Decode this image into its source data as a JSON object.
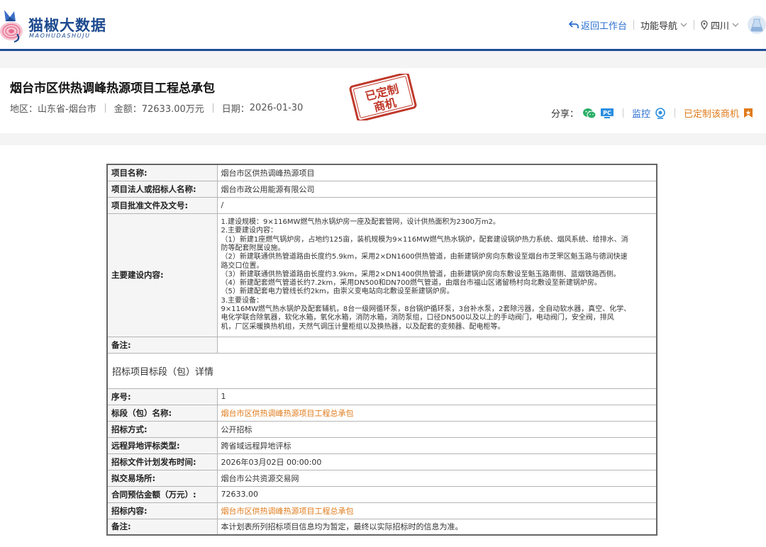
{
  "brand": {
    "name": "猫椒大数据",
    "sub": "MAOHUDASHUJU"
  },
  "nav": {
    "back_label": "返回工作台",
    "menu_label": "功能导航",
    "region_label": "四川"
  },
  "project": {
    "title": "烟台市区供热调峰热源项目工程总承包",
    "region_label": "地区：",
    "region_value": "山东省-烟台市",
    "amount_label": "金额：",
    "amount_value": "72633.00万元",
    "date_label": "日期：",
    "date_value": "2026-01-30",
    "stamp_line1": "已定制",
    "stamp_line2": "商机"
  },
  "actions": {
    "share_label": "分享：",
    "monitor_label": "监控",
    "custom_label": "已定制该商机"
  },
  "colors": {
    "brand_blue": "#1e4a8f",
    "link_blue": "#2a6fd1",
    "accent_orange": "#e07a1a",
    "stamp_red": "#c0392b",
    "wechat_green": "#2aae67"
  },
  "table": {
    "project_name_label": "项目名称:",
    "project_name": "烟台市区供热调峰热源项目",
    "owner_label": "项目法人或招标人名称:",
    "owner": "烟台市政公用能源有限公司",
    "approval_label": "项目批准文件及文号:",
    "approval": "/",
    "content_label": "主要建设内容:",
    "content_lines": [
      "1.建设规模：9×116MW燃气热水锅炉房一座及配套管网，设计供热面积为2300万m2。",
      "2.主要建设内容：",
      "（1）新建1座燃气锅炉房，占地约125亩，装机规模为9×116MW燃气热水锅炉，配套建设锅炉热力系统、烟风系统、给排水、消",
      "防等配套附属设施。",
      "（2）新建联通供热管道路由长度约5.9km，采用2×DN1600供热管道，由新建锅炉房向东敷设至烟台市芝罘区魁玉路与德润快速",
      "路交口位置。",
      "（3）新建联通供热管道路由长度约3.9km，采用2×DN1400供热管道，由新建锅炉房向东敷设至魁玉路南侧、蓝烟铁路西侧。",
      "（4）新建配套燃气管道长约7.2km，采用DN500和DN700燃气管道，由烟台市福山区诸留杨村向北敷设至新建锅炉房。",
      "（5）新建配套电力管线长约2km，由崇义变电站向北敷设至新建锅炉房。",
      "3.主要设备：",
      "9×116MW燃气热水锅炉及配套辅机，8台一级网循环泵，8台锅炉循环泵，3台补水泵，2套除污器，全自动软水器，真空、化学、",
      "电化学联合除氧器，软化水箱，氧化水箱，消防水箱，消防泵组，口径DN500以及以上的手动阀门，电动阀门，安全阀，排风",
      "机，厂区采暖换热机组，天然气调压计量柜组以及换热器，以及配套的变频器、配电柜等。"
    ],
    "remark_label": "备注:",
    "remark": "",
    "section_title": "招标项目标段（包）详情",
    "seq_label": "序号:",
    "seq": "1",
    "lot_label": "标段（包）名称:",
    "lot": "烟台市区供热调峰热源项目工程总承包",
    "method_label": "招标方式:",
    "method": "公开招标",
    "remote_label": "远程异地评标类型:",
    "remote": "跨省域远程异地评标",
    "publish_label": "招标文件计划发布时间:",
    "publish": "2026年03月02日 00:00:00",
    "venue_label": "拟交易场所:",
    "venue": "烟台市公共资源交易网",
    "estimate_label": "合同预估金额（万元）:",
    "estimate": "72633.00",
    "bid_content_label": "招标内容:",
    "bid_content": "烟台市区供热调峰热源项目工程总承包",
    "note_label": "备注:",
    "note": "本计划表所列招标项目信息均为暂定，最终以实际招标时的信息为准。"
  }
}
